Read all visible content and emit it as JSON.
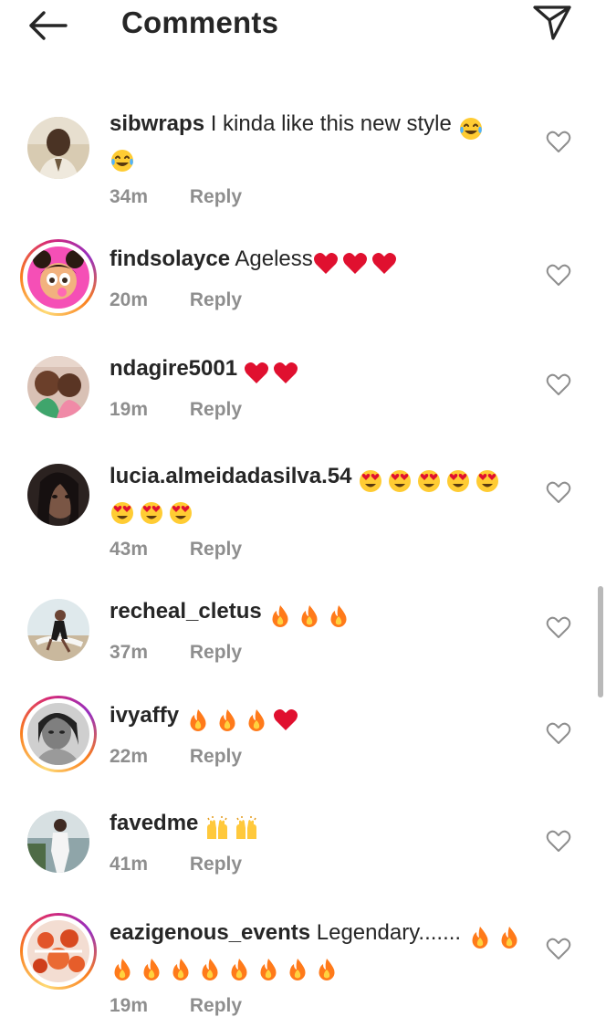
{
  "header": {
    "title": "Comments",
    "back_icon": "arrow-left-icon",
    "share_icon": "paper-plane-icon"
  },
  "colors": {
    "text": "#262626",
    "meta": "#8e8e8e",
    "heart_red": "#e0102f"
  },
  "comments": [
    {
      "username": "sibwraps",
      "text": "I kinda like this new style",
      "emoji": [
        "tears-of-joy",
        "tears-of-joy"
      ],
      "time": "34m",
      "reply": "Reply",
      "story_ring": false
    },
    {
      "username": "findsolayce",
      "text": "Ageless",
      "emoji": [
        "red-heart",
        "red-heart",
        "red-heart"
      ],
      "time": "20m",
      "reply": "Reply",
      "story_ring": true
    },
    {
      "username": "ndagire5001",
      "text": "",
      "emoji": [
        "red-heart",
        "red-heart"
      ],
      "time": "19m",
      "reply": "Reply",
      "story_ring": false
    },
    {
      "username": "lucia.almeidadasilva.54",
      "text": "",
      "emoji": [
        "heart-eyes",
        "heart-eyes",
        "heart-eyes",
        "heart-eyes",
        "heart-eyes",
        "heart-eyes",
        "heart-eyes",
        "heart-eyes"
      ],
      "time": "43m",
      "reply": "Reply",
      "story_ring": false
    },
    {
      "username": "recheal_cletus",
      "text": "",
      "emoji": [
        "fire",
        "fire",
        "fire"
      ],
      "time": "37m",
      "reply": "Reply",
      "story_ring": false
    },
    {
      "username": "ivyaffy",
      "text": "",
      "emoji": [
        "fire",
        "fire",
        "fire",
        "red-heart"
      ],
      "time": "22m",
      "reply": "Reply",
      "story_ring": true
    },
    {
      "username": "favedme",
      "text": "",
      "emoji": [
        "raising-hands",
        "raising-hands"
      ],
      "time": "41m",
      "reply": "Reply",
      "story_ring": false
    },
    {
      "username": "eazigenous_events",
      "text": "Legendary.......",
      "emoji": [
        "fire",
        "fire",
        "fire",
        "fire",
        "fire",
        "fire",
        "fire",
        "fire",
        "fire",
        "fire"
      ],
      "time": "19m",
      "reply": "Reply",
      "story_ring": true
    }
  ]
}
